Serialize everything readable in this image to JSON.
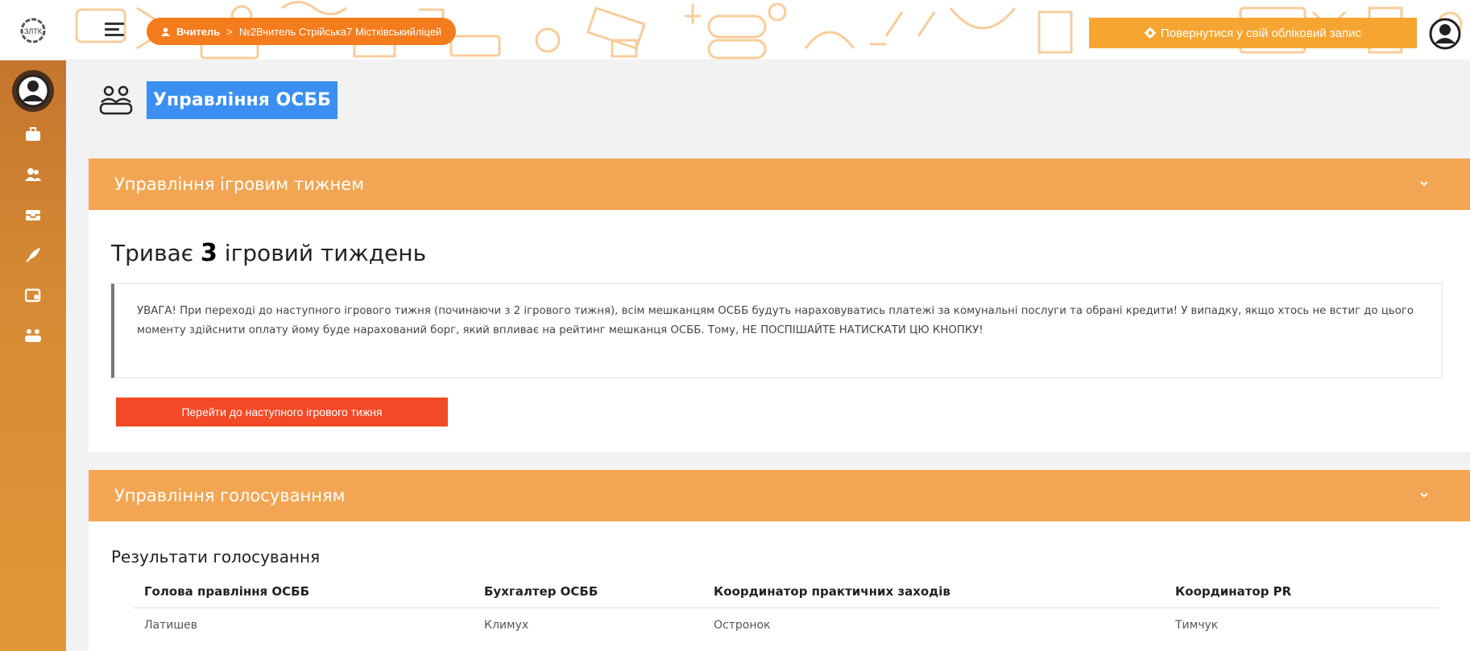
{
  "header": {
    "breadcrumb_root": "Вчитель",
    "breadcrumb_sep": ">",
    "breadcrumb_current": "№2Вчитель Стрійська7 Містківськийліцей",
    "return_button": "Повернутися у свій обліковий запис"
  },
  "sidebar": {
    "items": [
      {
        "icon": "briefcase-icon"
      },
      {
        "icon": "users-icon"
      },
      {
        "icon": "inbox-icon"
      },
      {
        "icon": "rocket-icon"
      },
      {
        "icon": "wallet-icon"
      },
      {
        "icon": "community-icon"
      }
    ]
  },
  "page": {
    "title": "Управління ОСББ"
  },
  "week_section": {
    "header": "Управління ігровим тижнем",
    "status_prefix": "Триває",
    "week_number": "3",
    "status_suffix": "ігровий тиждень",
    "warning": "УВАГА! При переході до наступного ігрового тижня (починаючи з 2 ігрового тижня), всім мешканцям ОСББ будуть нараховуватись платежі за комунальні послуги та обрані кредити! У випадку, якщо хтось не встиг до цього моменту здійснити оплату йому буде нарахований борг, який впливає на рейтинг мешканця ОСББ. Тому, НЕ ПОСПІШАЙТЕ НАТИСКАТИ ЦЮ КНОПКУ!",
    "next_button": "Перейти до наступного ігрового тижня"
  },
  "vote_section": {
    "header": "Управління голосуванням",
    "results_title": "Результати голосування",
    "columns": [
      "Голова правління ОСББ",
      "Бухгалтер ОСББ",
      "Координатор практичних заходів",
      "Координатор PR"
    ],
    "row": [
      "Латишев",
      "Климух",
      "Остронок",
      "Тимчук"
    ]
  },
  "colors": {
    "accent_orange": "#f47c1c",
    "section_header": "#f2a653",
    "danger_button": "#f24a26",
    "title_highlight": "#3b8ff0"
  }
}
